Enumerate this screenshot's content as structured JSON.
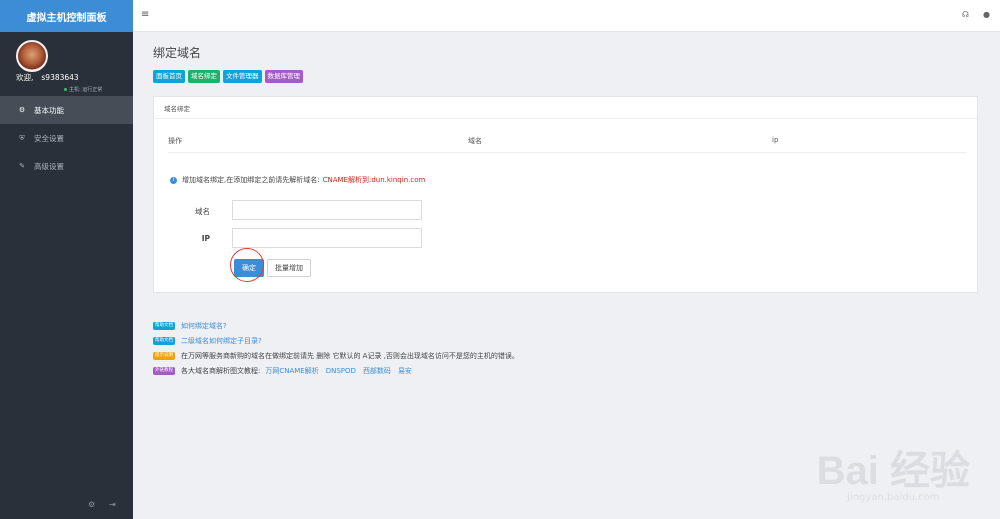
{
  "sidebar": {
    "brand": "虚拟主机控制面板",
    "welcome_prefix": "欢迎,",
    "username": "s9383643",
    "host_status": "主机: 运行正常",
    "items": [
      {
        "label": "基本功能",
        "icon": "gears-icon"
      },
      {
        "label": "安全设置",
        "icon": "shield-icon"
      },
      {
        "label": "高级设置",
        "icon": "edit-icon"
      }
    ]
  },
  "topbar": {
    "menu_icon": "≡",
    "headset_icon": "🎧",
    "user_icon": "👤"
  },
  "page": {
    "title": "绑定域名",
    "tabs": [
      {
        "label": "面板首页",
        "color": "#0ea4d8"
      },
      {
        "label": "域名绑定",
        "color": "#19b46a"
      },
      {
        "label": "文件管理器",
        "color": "#0ea4d8"
      },
      {
        "label": "数据库管理",
        "color": "#a35bc6"
      }
    ]
  },
  "card": {
    "title": "域名绑定",
    "columns": [
      "操作",
      "域名",
      "ip"
    ],
    "notice_text": "增加域名绑定,在添加绑定之前请先解析域名:",
    "notice_red": "CNAME解析到:dun.kinqin.com",
    "domain_label": "域名",
    "ip_label": "IP",
    "domain_value": "",
    "ip_value": "",
    "ok_label": "确定",
    "batch_label": "批量增加"
  },
  "help": {
    "row1_badge": "帮助文档",
    "row1_link": "如何绑定域名?",
    "row2_badge": "帮助文档",
    "row2_link": "二级域名如何绑定子目录?",
    "row3_badge": "提示说明",
    "row3_text": "在万网等服务商新购的域名在做绑定前请先 删除 它默认的 A记录 ,否则会出现域名访问不是您的主机的错误。",
    "row4_badge": "外链教程",
    "row4_text": "各大域名商解析图文教程:",
    "row4_links": [
      "万网CNAME解析",
      "DNSPOD",
      "西部数码",
      "易安"
    ],
    "colors": {
      "blue": "#0ea4d8",
      "orange": "#f0a20a",
      "purple": "#a35bc6"
    }
  },
  "watermark": {
    "main": "Bai 经验",
    "sub": "jingyan.baidu.com"
  }
}
